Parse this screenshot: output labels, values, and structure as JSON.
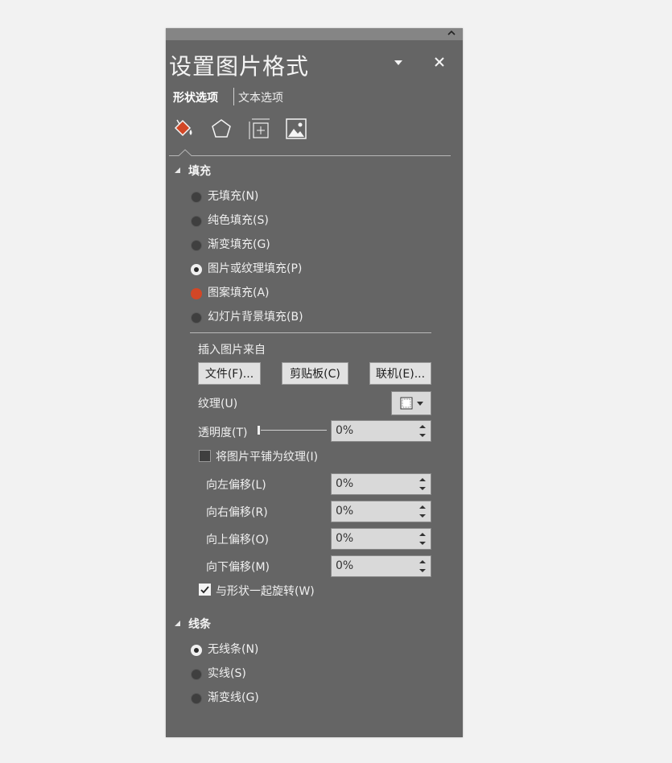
{
  "pane": {
    "title": "设置图片格式",
    "tabs": {
      "shape": "形状选项",
      "text": "文本选项"
    },
    "icons": [
      "fill-line-icon",
      "effects-pentagon-icon",
      "size-properties-icon",
      "picture-icon"
    ]
  },
  "fill": {
    "header": "填充",
    "options": [
      {
        "label": "无填充(N)",
        "state": "off"
      },
      {
        "label": "纯色填充(S)",
        "state": "off"
      },
      {
        "label": "渐变填充(G)",
        "state": "off"
      },
      {
        "label": "图片或纹理填充(P)",
        "state": "selected"
      },
      {
        "label": "图案填充(A)",
        "state": "highlight"
      },
      {
        "label": "幻灯片背景填充(B)",
        "state": "off"
      }
    ],
    "insert_from_label": "插入图片来自",
    "buttons": {
      "file": "文件(F)...",
      "clipboard": "剪贴板(C)",
      "online": "联机(E)..."
    },
    "texture_label": "纹理(U)",
    "transparency_label": "透明度(T)",
    "transparency_value": "0%",
    "tile_label": "将图片平铺为纹理(I)",
    "tile_checked": false,
    "offsets": [
      {
        "label": "向左偏移(L)",
        "value": "0%"
      },
      {
        "label": "向右偏移(R)",
        "value": "0%"
      },
      {
        "label": "向上偏移(O)",
        "value": "0%"
      },
      {
        "label": "向下偏移(M)",
        "value": "0%"
      }
    ],
    "rotate_label": "与形状一起旋转(W)",
    "rotate_checked": true
  },
  "line": {
    "header": "线条",
    "options": [
      {
        "label": "无线条(N)",
        "state": "selected"
      },
      {
        "label": "实线(S)",
        "state": "off"
      },
      {
        "label": "渐变线(G)",
        "state": "off"
      }
    ]
  },
  "colors": {
    "pane_bg": "#656565",
    "accent_red": "#d24726",
    "field_bg": "#d9d9d9"
  }
}
